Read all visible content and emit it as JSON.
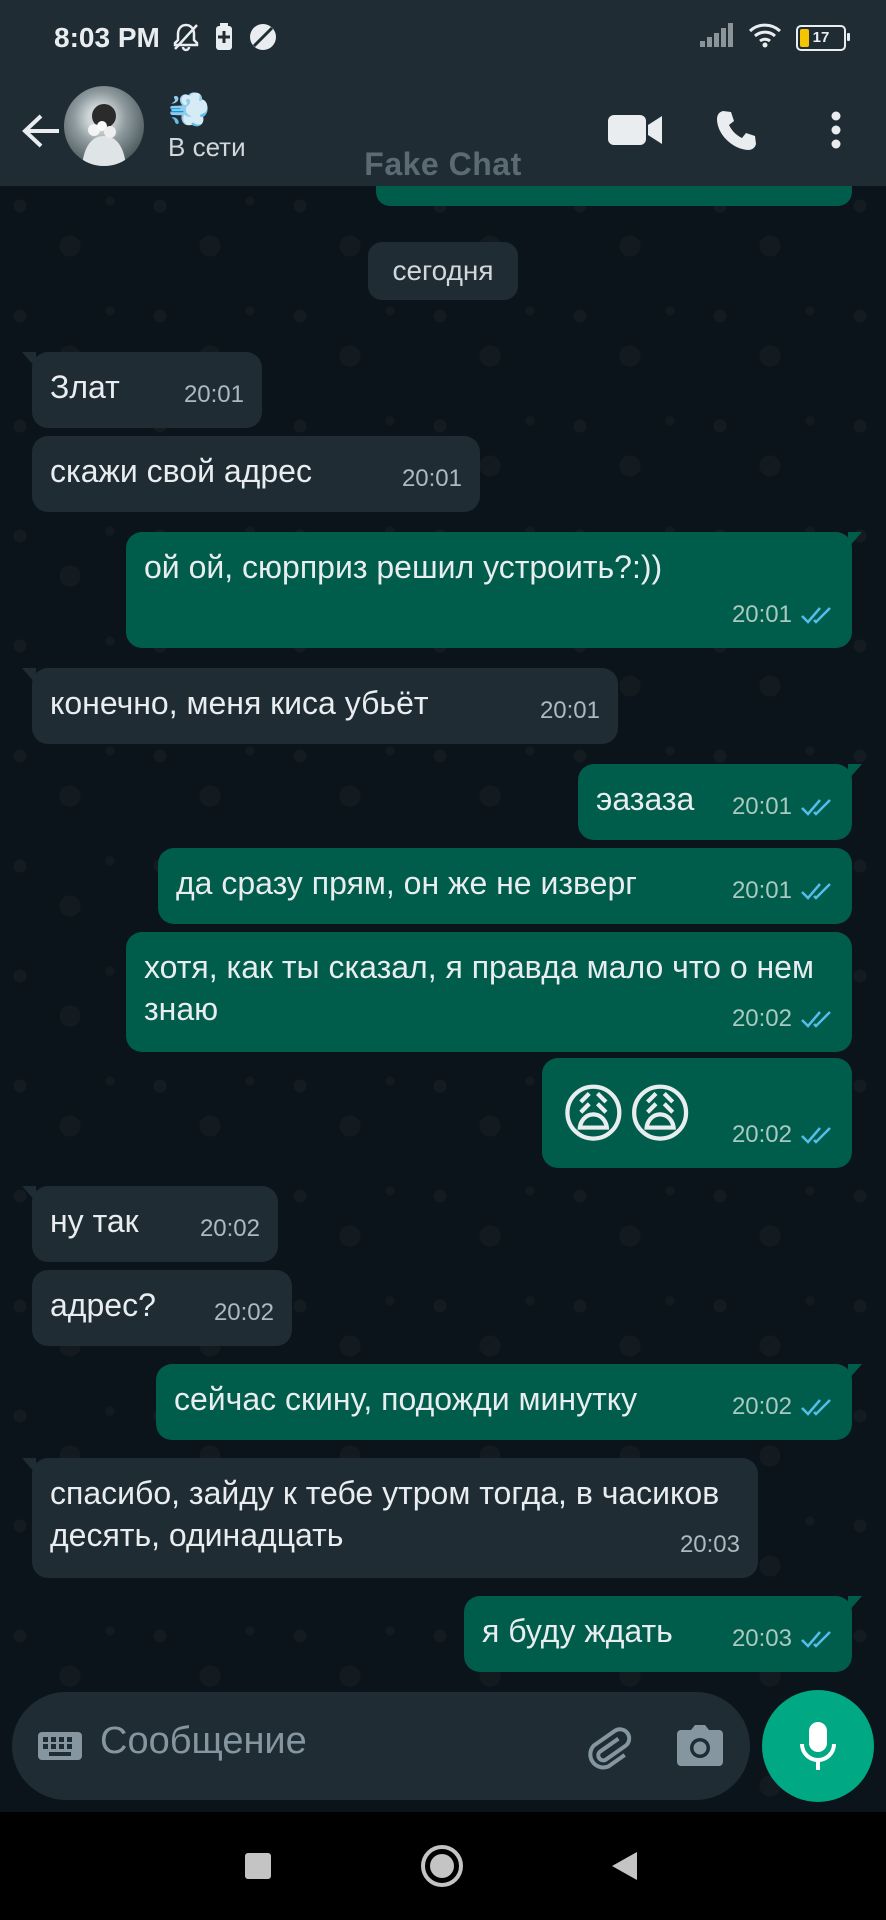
{
  "status_bar": {
    "time": "8:03 PM",
    "battery": "17",
    "icons": [
      "mute-bell-icon",
      "battery-saver-icon",
      "no-disturb-icon",
      "signal-icon",
      "wifi-icon",
      "battery-icon"
    ]
  },
  "header": {
    "contact_name": "💨",
    "status": "В сети",
    "watermark": "Fake Chat",
    "icons": [
      "back-arrow-icon",
      "video-call-icon",
      "phone-icon",
      "more-vert-icon"
    ]
  },
  "chat": {
    "date_chip": "сегодня",
    "messages": [
      {
        "dir": "in",
        "text": "Злат",
        "time": "20:01"
      },
      {
        "dir": "in",
        "text": "скажи свой адрес",
        "time": "20:01"
      },
      {
        "dir": "out",
        "text": "ой ой, сюрприз решил устроить?:))",
        "time": "20:01",
        "read": true
      },
      {
        "dir": "in",
        "text": "конечно, меня киса убьёт",
        "time": "20:01"
      },
      {
        "dir": "out",
        "text": "эазаза",
        "time": "20:01",
        "read": true
      },
      {
        "dir": "out",
        "text": "да сразу прям, он же не изверг",
        "time": "20:01",
        "read": true
      },
      {
        "dir": "out",
        "text": "хотя, как ты сказал, я правда мало что о нем знаю",
        "time": "20:02",
        "read": true
      },
      {
        "dir": "out",
        "text": "😩😩",
        "time": "20:02",
        "read": true
      },
      {
        "dir": "in",
        "text": "ну так",
        "time": "20:02"
      },
      {
        "dir": "in",
        "text": "адрес?",
        "time": "20:02"
      },
      {
        "dir": "out",
        "text": "сейчас скину, подожди минутку",
        "time": "20:02",
        "read": true
      },
      {
        "dir": "in",
        "text": "спасибо, зайду к тебе утром тогда, в часиков десять, одинадцать",
        "time": "20:03"
      },
      {
        "dir": "out",
        "text": "я буду ждать",
        "time": "20:03",
        "read": true
      }
    ]
  },
  "composer": {
    "placeholder": "Сообщение",
    "icons": [
      "keyboard-icon",
      "attach-icon",
      "camera-icon",
      "mic-icon"
    ]
  },
  "colors": {
    "background": "#0b141a",
    "incoming_bubble": "#1f2c34",
    "outgoing_bubble": "#005c4b",
    "accent": "#00a884",
    "read_ticks": "#53bdeb"
  }
}
